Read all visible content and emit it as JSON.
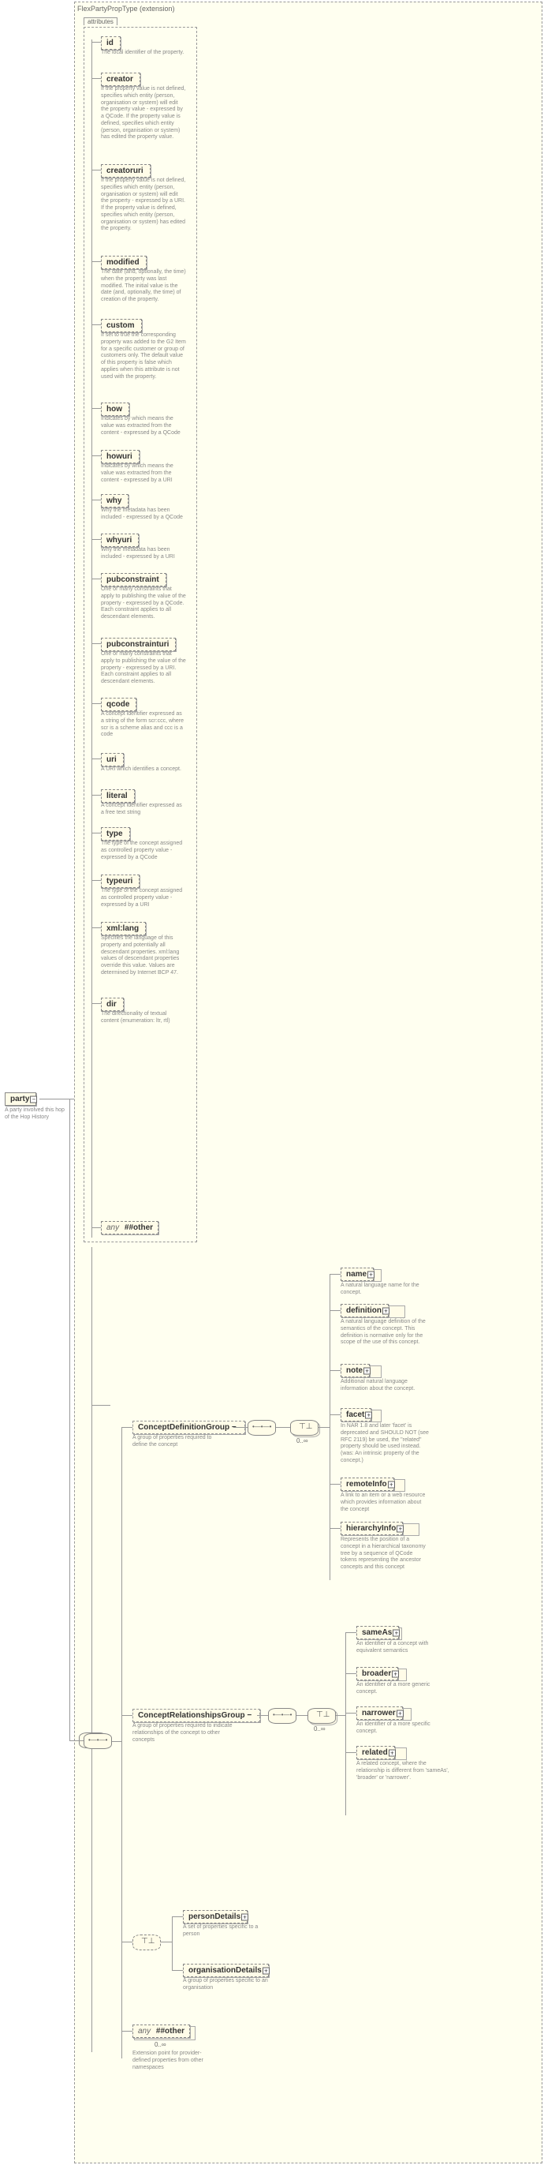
{
  "extension_label": "FlexPartyPropType (extension)",
  "attributes_label": "attributes",
  "party": {
    "label": "party",
    "desc": "A party involved this hop of the Hop History"
  },
  "attrs": [
    {
      "name": "id",
      "desc": "The local identifier of the property."
    },
    {
      "name": "creator",
      "desc": "If the property value is not defined, specifies which entity (person, organisation or system) will edit the property value - expressed by a QCode. If the property value is defined, specifies which entity (person, organisation or system) has edited the property value."
    },
    {
      "name": "creatoruri",
      "desc": "If the property value is not defined, specifies which entity (person, organisation or system) will edit the property - expressed by a URI. If the property value is defined, specifies which entity (person, organisation or system) has edited the property."
    },
    {
      "name": "modified",
      "desc": "The date (and, optionally, the time) when the property was last modified. The initial value is the date (and, optionally, the time) of creation of the property."
    },
    {
      "name": "custom",
      "desc": "If set to true the corresponding property was added to the G2 Item for a specific customer or group of customers only. The default value of this property is false which applies when this attribute is not used with the property."
    },
    {
      "name": "how",
      "desc": "Indicates by which means the value was extracted from the content - expressed by a QCode"
    },
    {
      "name": "howuri",
      "desc": "Indicates by which means the value was extracted from the content - expressed by a URI"
    },
    {
      "name": "why",
      "desc": "Why the metadata has been included - expressed by a QCode"
    },
    {
      "name": "whyuri",
      "desc": "Why the metadata has been included - expressed by a URI"
    },
    {
      "name": "pubconstraint",
      "desc": "One or many constraints that apply to publishing the value of the property - expressed by a QCode. Each constraint applies to all descendant elements."
    },
    {
      "name": "pubconstrainturi",
      "desc": "One or many constraints that apply to publishing the value of the property - expressed by a URI. Each constraint applies to all descendant elements."
    },
    {
      "name": "qcode",
      "desc": "A concept identifier expressed as a string of the form scr:ccc, where scr is a scheme alias and ccc is a code"
    },
    {
      "name": "uri",
      "desc": "A URI which identifies a concept."
    },
    {
      "name": "literal",
      "desc": "A concept identifier expressed as a free text string"
    },
    {
      "name": "type",
      "desc": "The type of the concept assigned as controlled property value - expressed by a QCode"
    },
    {
      "name": "typeuri",
      "desc": "The type of the concept assigned as controlled property value - expressed by a URI"
    },
    {
      "name": "xml:lang",
      "desc": "Specifies the language of this property and potentially all descendant properties. xml:lang values of descendant properties override this value. Values are determined by Internet BCP 47."
    },
    {
      "name": "dir",
      "desc": "The directionality of textual content (enumeration: ltr, rtl)"
    }
  ],
  "attr_any": {
    "kw": "any",
    "ns": "##other"
  },
  "groups": {
    "cdg": {
      "label": "ConceptDefinitionGroup",
      "desc": "A group of properties required to define the concept"
    },
    "crg": {
      "label": "ConceptRelationshipsGroup",
      "desc": "A group of properties required to indicate relationships of the concept to other concepts"
    }
  },
  "cdg_items": [
    {
      "name": "name",
      "desc": "A natural language name for the concept."
    },
    {
      "name": "definition",
      "desc": "A natural language definition of the semantics of the concept. This definition is normative only for the scope of the use of this concept."
    },
    {
      "name": "note",
      "desc": "Additional natural language information about the concept."
    },
    {
      "name": "facet",
      "desc": "In NAR 1.8 and later 'facet' is deprecated and SHOULD NOT (see RFC 2119) be used, the \"related\" property should be used instead. (was: An intrinsic property of the concept.)"
    },
    {
      "name": "remoteInfo",
      "desc": "A link to an item or a web resource which provides information about the concept"
    },
    {
      "name": "hierarchyInfo",
      "desc": "Represents the position of a concept in a hierarchical taxonomy tree by a sequence of QCode tokens representing the ancestor concepts and this concept"
    }
  ],
  "crg_items": [
    {
      "name": "sameAs",
      "desc": "An identifier of a concept with equivalent semantics"
    },
    {
      "name": "broader",
      "desc": "An identifier of a more generic concept."
    },
    {
      "name": "narrower",
      "desc": "An identifier of a more specific concept."
    },
    {
      "name": "related",
      "desc": "A related concept, where the relationship is different from 'sameAs', 'broader' or 'narrower'."
    }
  ],
  "details": {
    "person": {
      "label": "personDetails",
      "desc": "A set of properties specific to a person"
    },
    "org": {
      "label": "organisationDetails",
      "desc": "A group of properties specific to an organisation"
    }
  },
  "bottom_any": {
    "kw": "any",
    "ns": "##other",
    "desc": "Extension point for provider-defined properties from other namespaces"
  },
  "occ": "0..∞"
}
